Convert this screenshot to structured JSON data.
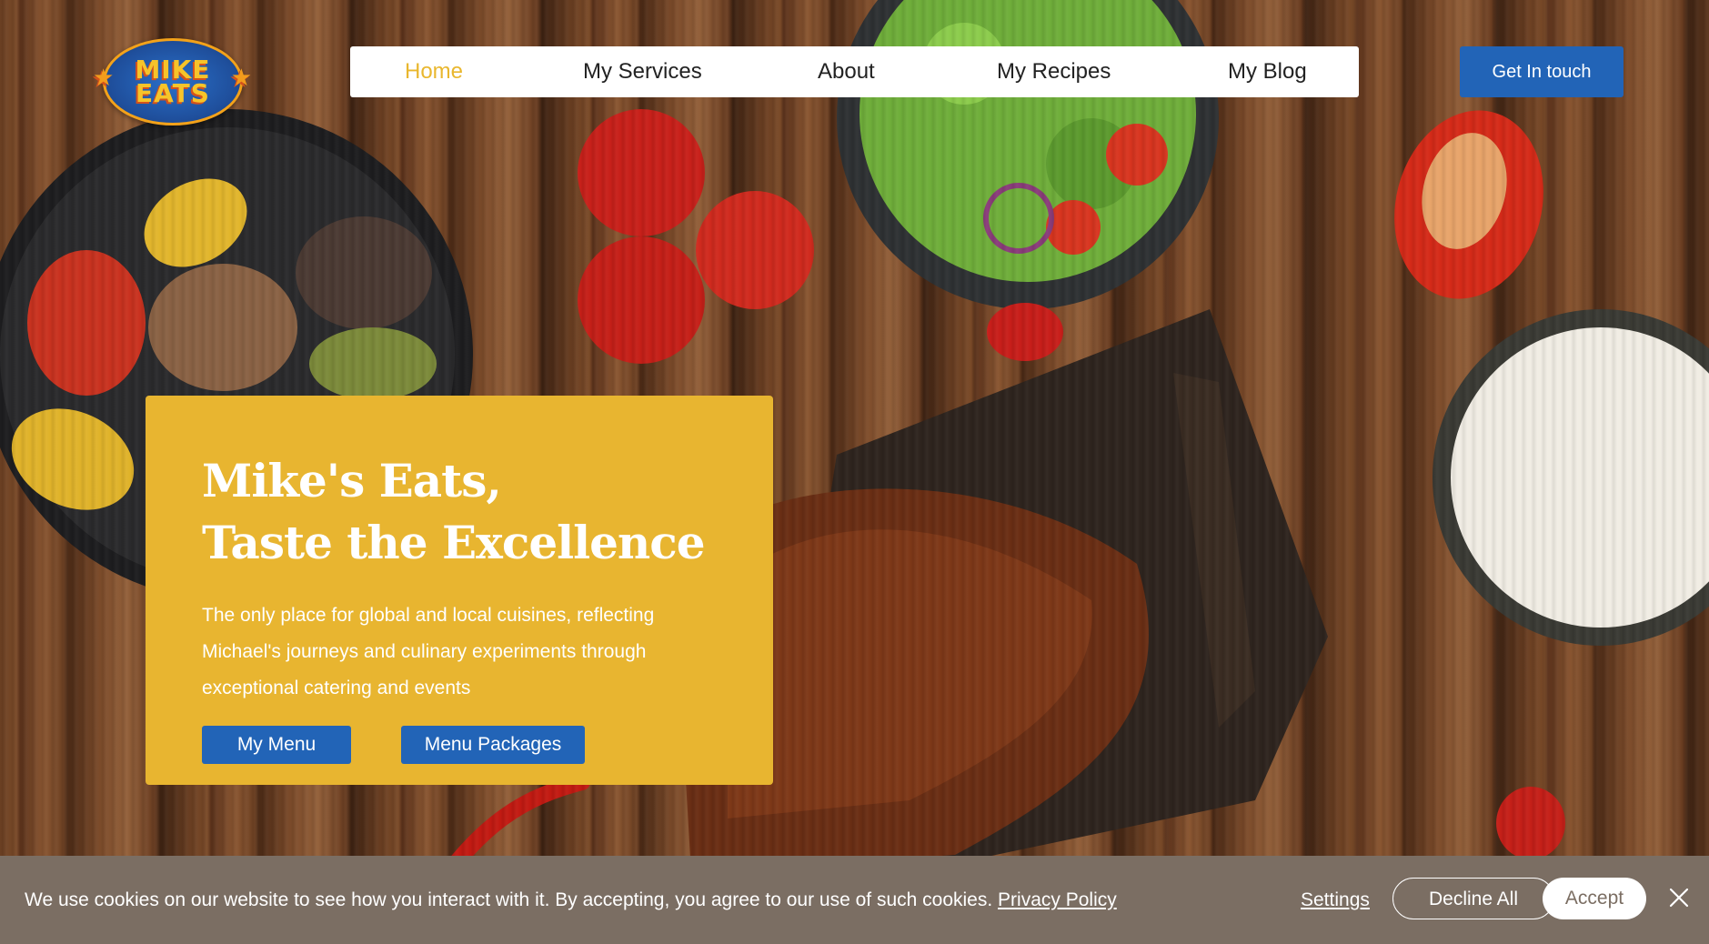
{
  "logo": {
    "line1": "MIKE",
    "line2": "EATS"
  },
  "nav": {
    "items": [
      {
        "label": "Home",
        "active": true
      },
      {
        "label": "My Services",
        "active": false
      },
      {
        "label": "About",
        "active": false
      },
      {
        "label": "My Recipes",
        "active": false
      },
      {
        "label": "My Blog",
        "active": false
      }
    ],
    "cta_label": "Get In touch"
  },
  "hero": {
    "title_line1": "Mike's Eats,",
    "title_line2": "Taste the Excellence",
    "description": "The only place for global and local cuisines, reflecting Michael's journeys and culinary experiments through exceptional catering and events",
    "button_menu": "My Menu",
    "button_packages": "Menu Packages"
  },
  "cookie": {
    "message": "We use cookies on our website to see how you interact with it. By accepting, you agree to our use of such cookies.",
    "privacy_link": "Privacy Policy",
    "settings_label": "Settings",
    "decline_label": "Decline All",
    "accept_label": "Accept"
  },
  "colors": {
    "accent_yellow": "#e8b530",
    "brand_blue": "#2264b7",
    "cookie_bar": "#7b6e63",
    "nav_active": "#e9b72e"
  },
  "icons": {
    "close": "close-icon",
    "logo_star": "star-icon"
  }
}
